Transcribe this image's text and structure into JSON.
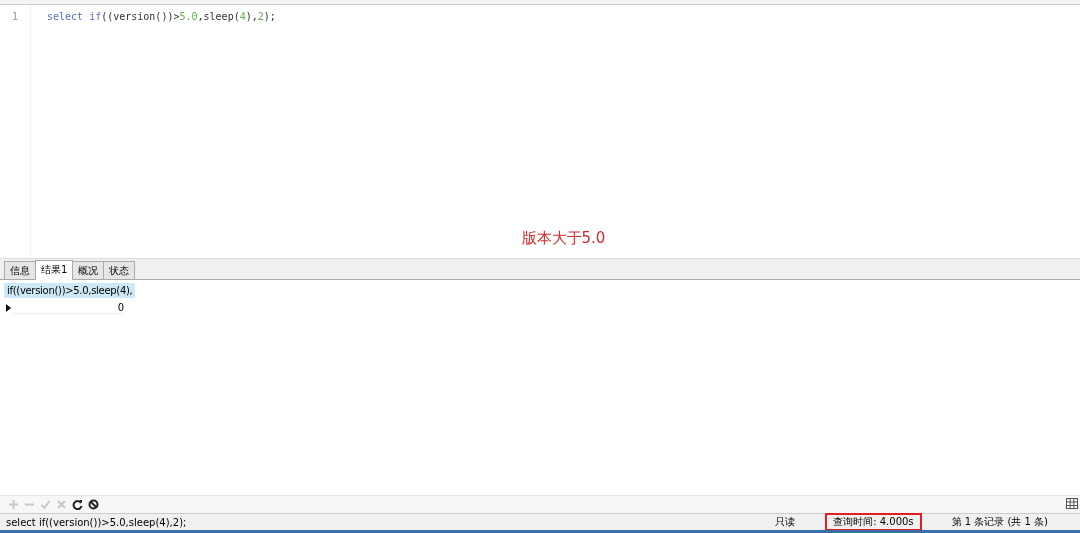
{
  "editor": {
    "lines": [
      {
        "number": "1",
        "tokens": [
          {
            "text": "select if",
            "kind": "keyword"
          },
          {
            "text": "((version())>",
            "kind": "plain"
          },
          {
            "text": "5.0",
            "kind": "number"
          },
          {
            "text": ",sleep(",
            "kind": "plain"
          },
          {
            "text": "4",
            "kind": "number"
          },
          {
            "text": "),",
            "kind": "plain"
          },
          {
            "text": "2",
            "kind": "number"
          },
          {
            "text": ");",
            "kind": "plain"
          }
        ]
      }
    ]
  },
  "annotation": "版本大于5.0",
  "tabs": [
    {
      "label": "信息",
      "selected": false
    },
    {
      "label": "结果1",
      "selected": true
    },
    {
      "label": "概况",
      "selected": false
    },
    {
      "label": "状态",
      "selected": false
    }
  ],
  "grid": {
    "columns": [
      "if((version())>5.0,sleep(4),"
    ],
    "rows": [
      {
        "current": true,
        "cells": [
          "0"
        ]
      }
    ]
  },
  "toolbar": [
    {
      "kind": "add",
      "disabled": true
    },
    {
      "kind": "remove",
      "disabled": true
    },
    {
      "kind": "apply",
      "disabled": true
    },
    {
      "kind": "cancel",
      "disabled": true
    },
    {
      "kind": "refresh",
      "disabled": false
    },
    {
      "kind": "stop",
      "disabled": false
    }
  ],
  "status_bar": {
    "query": "select if((version())>5.0,sleep(4),2);",
    "items": [
      {
        "text": "只读",
        "highlighted": false
      },
      {
        "text": "查询时间: 4.000s",
        "highlighted": true
      },
      {
        "text": "第 1 条记录 (共 1 条)",
        "highlighted": false
      }
    ]
  }
}
